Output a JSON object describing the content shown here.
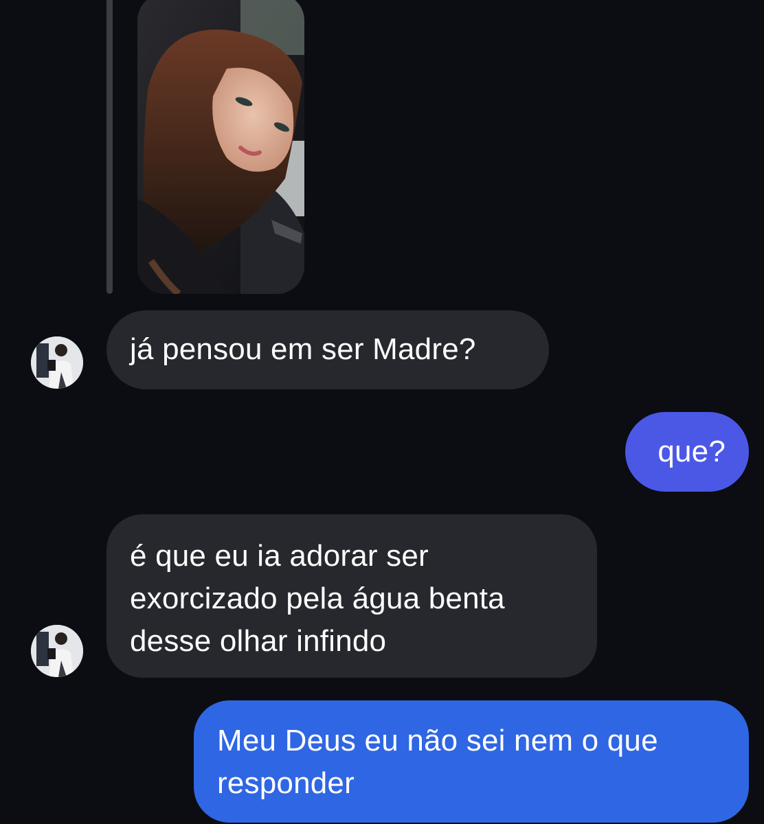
{
  "conversation": {
    "messages": [
      {
        "sender": "other",
        "type": "image",
        "image_icon": "selfie-photo",
        "alt": ""
      },
      {
        "sender": "other",
        "type": "text",
        "lines": [
          "já pensou em ser Madre?"
        ]
      },
      {
        "sender": "me",
        "type": "text",
        "lines": [
          "que?"
        ]
      },
      {
        "sender": "other",
        "type": "text",
        "lines": [
          "é que eu ia adorar ser",
          "exorcizado pela água benta",
          "desse olhar infindo"
        ]
      },
      {
        "sender": "me",
        "type": "text",
        "lines": [
          "Meu Deus eu não sei nem o que",
          "responder"
        ]
      }
    ]
  },
  "colors": {
    "background": "#0b0d12",
    "incoming_bubble": "#26282d",
    "outgoing_bubble_1": "#4b58e6",
    "outgoing_bubble_2": "#2f66e3",
    "text": "#ffffff"
  }
}
